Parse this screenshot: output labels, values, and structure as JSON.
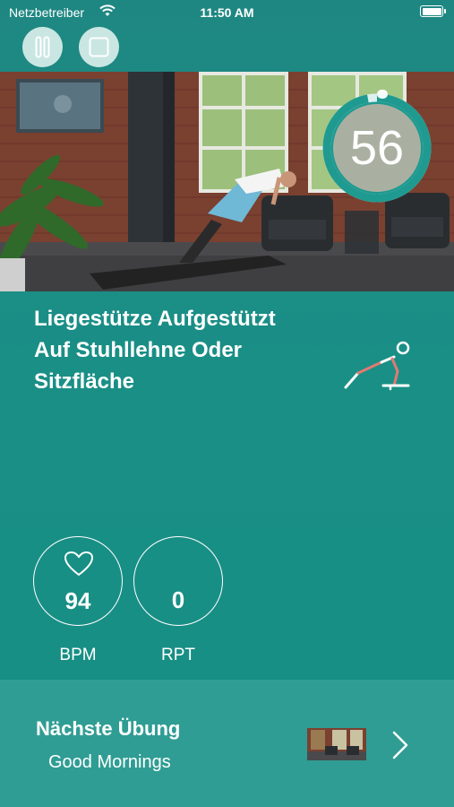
{
  "status_bar": {
    "carrier": "Netzbetreiber",
    "time": "11:50 AM",
    "wifi_icon": "wifi-icon",
    "battery_level": 1.0
  },
  "controls": {
    "pause_icon": "pause-icon",
    "stop_icon": "stop-icon",
    "color": "#c9e6e2"
  },
  "timer": {
    "seconds": "56",
    "progress_fraction": 0.97,
    "ring_color": "#1f9a90"
  },
  "exercise": {
    "title": "Liegestütze Aufgestützt Auf Stuhllehne Oder Sitzfläche",
    "icon": "pushup-figure-icon"
  },
  "stats": {
    "bpm": {
      "value": "94",
      "label": "BPM",
      "icon": "heart-icon"
    },
    "rpt": {
      "value": "0",
      "label": "RPT"
    }
  },
  "next_exercise": {
    "heading": "Nächste Übung",
    "name": "Good Mornings",
    "chevron_icon": "chevron-right-icon"
  },
  "colors": {
    "background": "#1a8f86",
    "accent_red": "#e05a5a"
  }
}
